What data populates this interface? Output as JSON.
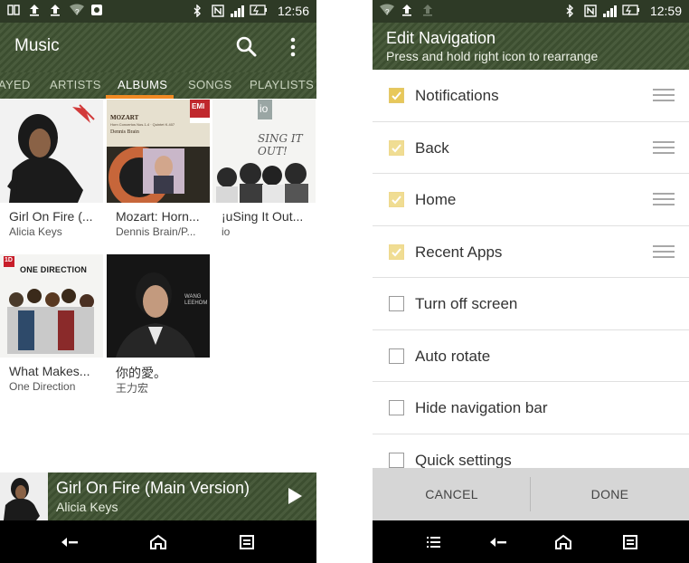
{
  "left": {
    "status_time": "12:56",
    "app_title": "Music",
    "tabs": [
      "AYED",
      "ARTISTS",
      "ALBUMS",
      "SONGS",
      "PLAYLISTS"
    ],
    "active_tab": "ALBUMS",
    "albums": [
      {
        "title": "Girl On Fire (...",
        "artist": "Alicia Keys"
      },
      {
        "title": "Mozart: Horn...",
        "artist": "Dennis Brain/P..."
      },
      {
        "title": "¡uSing It Out...",
        "artist": "io"
      },
      {
        "title": "What Makes...",
        "artist": "One Direction"
      },
      {
        "title": "你的愛。",
        "artist": "王力宏"
      }
    ],
    "cover_text": {
      "mozart_label": "MOZART",
      "mozart_sub": "Horn Concertos Nos.1-4 · Quintet K.407",
      "mozart_artist": "Dennis Brain",
      "emi": "EMI",
      "io_logo": "io",
      "io_title": "SING IT OUT!",
      "od_title": "ONE DIRECTION",
      "od_badge": "1D",
      "wang_text": "WANG LEEHOM"
    },
    "now_playing": {
      "title": "Girl On Fire (Main Version)",
      "artist": "Alicia Keys"
    },
    "icons": {
      "search": "search-icon",
      "overflow": "overflow-menu-icon",
      "play": "play-icon"
    }
  },
  "right": {
    "status_time": "12:59",
    "title": "Edit Navigation",
    "subtitle": "Press and hold right icon to rearrange",
    "items": [
      {
        "label": "Notifications",
        "checked": true,
        "faded": false
      },
      {
        "label": "Back",
        "checked": true,
        "faded": true
      },
      {
        "label": "Home",
        "checked": true,
        "faded": true
      },
      {
        "label": "Recent Apps",
        "checked": true,
        "faded": true
      },
      {
        "label": "Turn off screen",
        "checked": false
      },
      {
        "label": "Auto rotate",
        "checked": false
      },
      {
        "label": "Hide navigation bar",
        "checked": false
      },
      {
        "label": "Quick settings",
        "checked": false
      }
    ],
    "cancel_label": "CANCEL",
    "done_label": "DONE"
  },
  "colors": {
    "green": "#3f5232",
    "accent_orange": "#f08a24",
    "checkbox_yellow": "#e8c85a"
  }
}
